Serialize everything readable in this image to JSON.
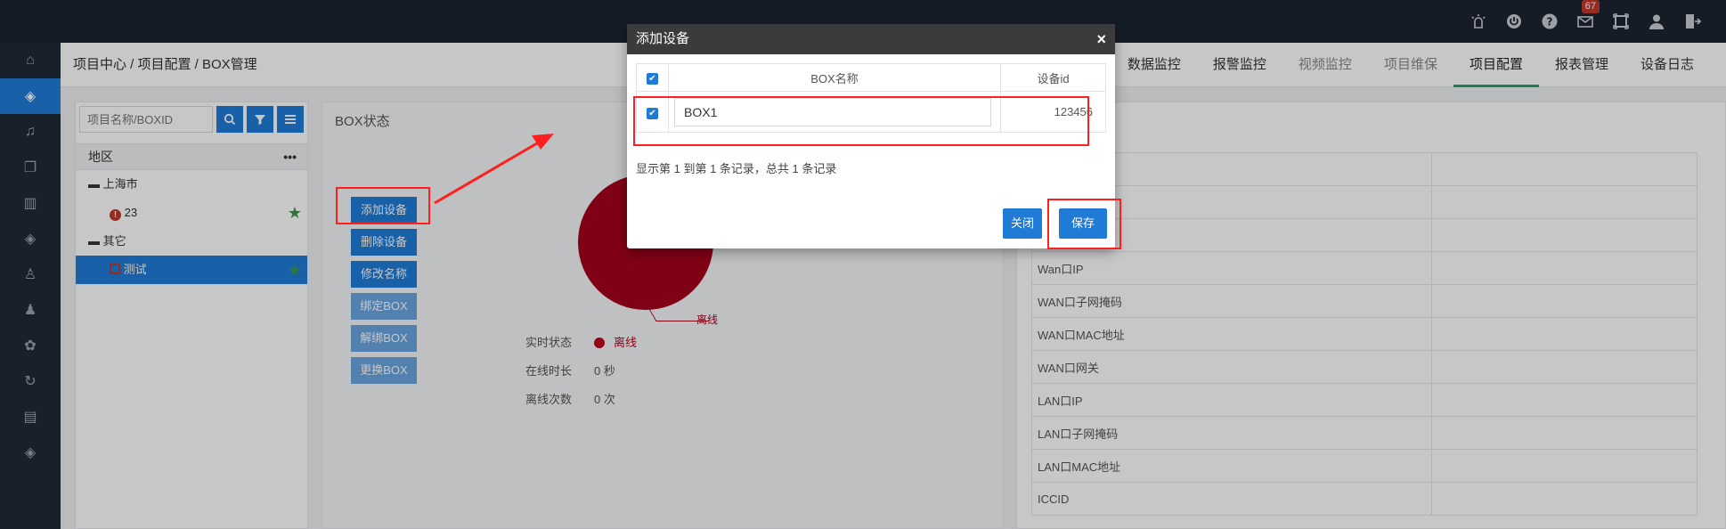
{
  "topbar": {
    "icons": [
      "alarm-icon",
      "power-icon",
      "help-icon",
      "mail-icon",
      "fullscreen-icon",
      "user-icon",
      "logout-icon"
    ],
    "mail_badge": "67"
  },
  "sidenav": {
    "items": [
      "home-icon",
      "layers-icon",
      "bell-icon",
      "copy-icon",
      "book-icon",
      "stack-icon",
      "person-icon",
      "group-icon",
      "palette-icon",
      "sync-icon",
      "document-icon",
      "layers-2-icon"
    ]
  },
  "header": {
    "breadcrumb": "项目中心 / 项目配置 / BOX管理",
    "tabs": [
      {
        "label": "数据监控"
      },
      {
        "label": "报警监控"
      },
      {
        "label": "视频监控"
      },
      {
        "label": "项目维保"
      },
      {
        "label": "项目配置"
      },
      {
        "label": "报表管理"
      },
      {
        "label": "设备日志"
      }
    ]
  },
  "left_panel": {
    "search_placeholder": "项目名称/BOXID",
    "region_header": "地区",
    "menu_dots": "•••",
    "tree": [
      {
        "prefix": "▬",
        "label": "上海市"
      },
      {
        "label": "23"
      },
      {
        "prefix": "▬",
        "label": "其它"
      },
      {
        "label": "测试"
      }
    ]
  },
  "mid_panel": {
    "title": "BOX状态",
    "buttons": [
      "添加设备",
      "删除设备",
      "修改名称",
      "绑定BOX",
      "解绑BOX",
      "更换BOX"
    ],
    "pie_label": "离线",
    "stats": [
      {
        "label": "实时状态",
        "value": "离线"
      },
      {
        "label": "在线时长",
        "value": "0 秒"
      },
      {
        "label": "离线次数",
        "value": "0 次"
      }
    ]
  },
  "right_panel": {
    "rows": [
      "",
      "",
      "",
      "Wan口IP",
      "WAN口子网掩码",
      "WAN口MAC地址",
      "WAN口网关",
      "LAN口IP",
      "LAN口子网掩码",
      "LAN口MAC地址",
      "ICCID"
    ]
  },
  "modal": {
    "title": "添加设备",
    "close": "×",
    "col_name": "BOX名称",
    "col_id": "设备id",
    "row_name": "BOX1",
    "row_id": "123456",
    "record_text": "显示第 1 到第 1 条记录，总共 1 条记录",
    "close_button": "关闭",
    "save_button": "保存"
  },
  "colors": {
    "accent": "#1f7bd6",
    "offline": "#a5001b",
    "active_tab": "#27a06a",
    "annotation": "#ff1f1f"
  }
}
